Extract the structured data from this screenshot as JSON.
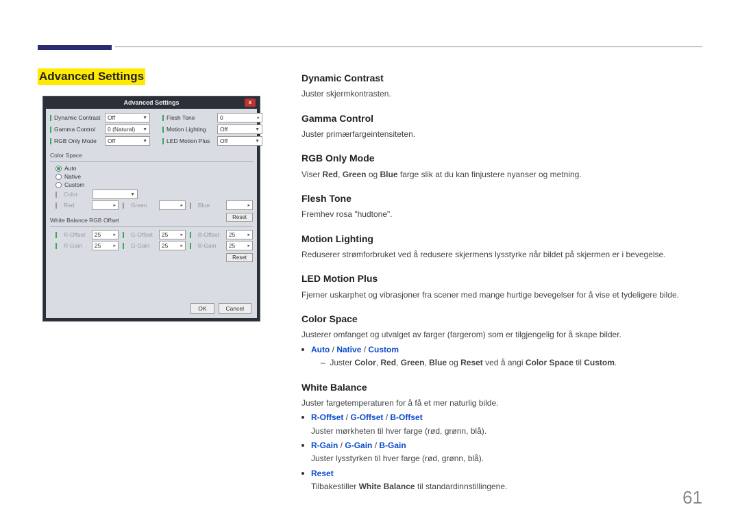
{
  "page": {
    "heading": "Advanced Settings",
    "number": "61"
  },
  "screenshot": {
    "title": "Advanced Settings",
    "close": "x",
    "rows": {
      "dynamic_contrast": {
        "label": "Dynamic Contrast",
        "value": "Off"
      },
      "gamma_control": {
        "label": "Gamma Control",
        "value": "0 (Natural)"
      },
      "rgb_only": {
        "label": "RGB Only Mode",
        "value": "Off"
      },
      "flesh_tone": {
        "label": "Flesh Tone",
        "value": "0"
      },
      "motion_lighting": {
        "label": "Motion Lighting",
        "value": "Off"
      },
      "led_motion": {
        "label": "LED Motion Plus",
        "value": "Off"
      }
    },
    "color_space": {
      "title": "Color Space",
      "auto": "Auto",
      "native": "Native",
      "custom": "Custom",
      "color": "Color",
      "red": "Red",
      "green": "Green",
      "blue": "Blue",
      "reset": "Reset"
    },
    "wb": {
      "title": "White Balance RGB Offset",
      "r_offset": {
        "label": "R-Offset",
        "value": "25"
      },
      "g_offset": {
        "label": "G-Offset",
        "value": "25"
      },
      "b_offset": {
        "label": "B-Offset",
        "value": "25"
      },
      "r_gain": {
        "label": "R-Gain",
        "value": "25"
      },
      "g_gain": {
        "label": "G-Gain",
        "value": "25"
      },
      "b_gain": {
        "label": "B-Gain",
        "value": "25"
      },
      "reset": "Reset"
    },
    "ok": "OK",
    "cancel": "Cancel"
  },
  "sections": {
    "dc": {
      "h": "Dynamic Contrast",
      "p": "Juster skjermkontrasten."
    },
    "gc": {
      "h": "Gamma Control",
      "p": "Juster primærfargeintensiteten."
    },
    "rgb": {
      "h": "RGB Only Mode",
      "p1": "Viser ",
      "red": "Red",
      "c1": ", ",
      "green": "Green",
      "c2": " og ",
      "blue": "Blue",
      "p2": " farge slik at du kan finjustere nyanser og metning."
    },
    "ft": {
      "h": "Flesh Tone",
      "p": "Fremhev rosa \"hudtone\"."
    },
    "ml": {
      "h": "Motion Lighting",
      "p": "Reduserer strømforbruket ved å redusere skjermens lysstyrke når bildet på skjermen er i bevegelse."
    },
    "lmp": {
      "h": "LED Motion Plus",
      "p": "Fjerner uskarphet og vibrasjoner fra scener med mange hurtige bevegelser for å vise et tydeligere bilde."
    },
    "cs": {
      "h": "Color Space",
      "p": "Justerer omfanget og utvalget av farger (fargerom) som er tilgjengelig for å skape bilder.",
      "opt_auto": "Auto",
      "sep": " / ",
      "opt_native": "Native",
      "opt_custom": "Custom",
      "sub_pre": "Juster ",
      "color": "Color",
      "c": ", ",
      "red": "Red",
      "green": "Green",
      "blue": "Blue",
      "og": " og ",
      "reset": "Reset",
      "mid": " ved å angi ",
      "cs2": "Color Space",
      "til": " til ",
      "custom2": "Custom",
      "dot": "."
    },
    "wb": {
      "h": "White Balance",
      "p": "Juster fargetemperaturen for å få et mer naturlig bilde.",
      "l1a": "R-Offset",
      "sep": " / ",
      "l1b": "G-Offset",
      "l1c": "B-Offset",
      "l1d": "Juster mørkheten til hver farge (rød, grønn, blå).",
      "l2a": "R-Gain",
      "l2b": "G-Gain",
      "l2c": "B-Gain",
      "l2d": "Juster lysstyrken til hver farge (rød, grønn, blå).",
      "l3a": "Reset",
      "l3b1": "Tilbakestiller ",
      "l3b2": "White Balance",
      "l3b3": " til standardinnstillingene."
    }
  }
}
